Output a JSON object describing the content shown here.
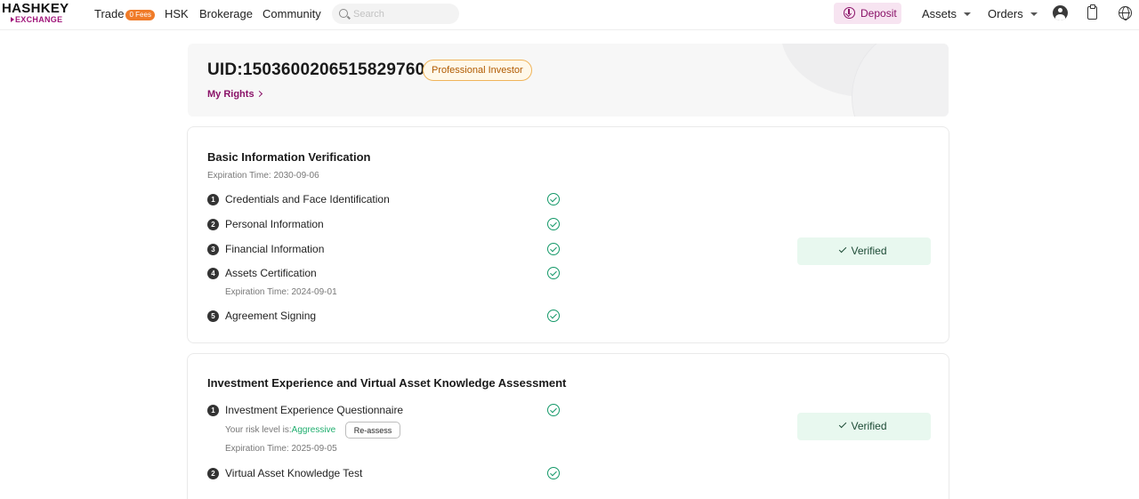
{
  "brand": {
    "logo_top": "HASHKEY",
    "logo_bottom": "EXCHANGE"
  },
  "nav": {
    "trade": "Trade",
    "trade_badge": "0 Fees",
    "hsk": "HSK",
    "brokerage": "Brokerage",
    "community": "Community",
    "search_placeholder": "Search",
    "deposit": "Deposit",
    "assets": "Assets",
    "orders": "Orders"
  },
  "account": {
    "uid": "UID:1503600206515829760",
    "investor_badge": "Professional Investor",
    "my_rights": "My Rights"
  },
  "basic": {
    "title": "Basic Information Verification",
    "expiration": "Expiration Time: 2030-09-06",
    "status": "Verified",
    "steps": [
      {
        "num": "1",
        "label": "Credentials and Face Identification"
      },
      {
        "num": "2",
        "label": "Personal Information"
      },
      {
        "num": "3",
        "label": "Financial Information"
      },
      {
        "num": "4",
        "label": "Assets Certification",
        "expiration": "Expiration Time: 2024-09-01"
      },
      {
        "num": "5",
        "label": "Agreement Signing"
      }
    ]
  },
  "investment": {
    "title": "Investment Experience and Virtual Asset Knowledge Assessment",
    "status": "Verified",
    "steps": [
      {
        "num": "1",
        "label": "Investment Experience Questionnaire",
        "risk_prefix": "Your risk level is:",
        "risk_level": "Aggressive",
        "reassess": "Re-assess",
        "expiration": "Expiration Time: 2025-09-05"
      },
      {
        "num": "2",
        "label": "Virtual Asset Knowledge Test"
      }
    ]
  },
  "colors": {
    "brand": "#8a1268",
    "success": "#139868",
    "verified_bg": "#e8f8ef",
    "badge_fees": "#f07b28"
  }
}
